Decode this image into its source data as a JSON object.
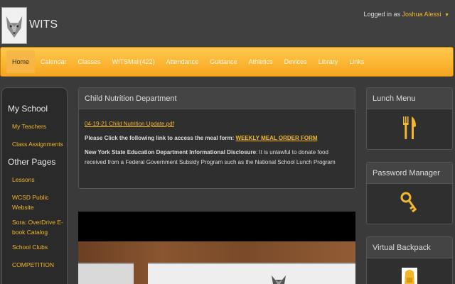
{
  "header": {
    "brand": "WITS",
    "logged_in_prefix": "Logged in as",
    "user": "Joshua Alessi"
  },
  "nav": {
    "items": [
      "Home",
      "Calendar",
      "Classes",
      "WITSMail(422)",
      "Attendance",
      "Guidance",
      "Athletics",
      "Devices",
      "Library",
      "Links"
    ],
    "active": "Home"
  },
  "sidebar": {
    "my_school_heading": "My School",
    "my_school_links": [
      "My Teachers",
      "Class Assignments"
    ],
    "other_pages_heading": "Other Pages",
    "other_links": [
      "Lessons",
      "WCSD Public Website",
      "Sora: OverDrive E-book Catalog",
      "School Clubs",
      "COMPETITION"
    ]
  },
  "main": {
    "title": "Child Nutrition Department",
    "pdf_link": "04-19-21 Child Nutrition Update.pdf",
    "instruction": "Please Click the following link to access the meal form:",
    "form_link": "WEEKLY MEAL ORDER FORM",
    "disclosure_label": "New York State Education Department Informational Disclosure",
    "disclosure_text": ": It is unlawful to donate food received from a Federal Government Subsidy Program such as the National School Lunch Program"
  },
  "right": {
    "lunch_title": "Lunch Menu",
    "lunch_icon": "fork-knife-icon",
    "password_title": "Password Manager",
    "password_icon": "key-icon",
    "backpack_title": "Virtual Backpack",
    "backpack_icon": "backpack-icon"
  },
  "colors": {
    "accent": "#f3b72b",
    "nav_top": "#ffc94d",
    "nav_bottom": "#f6a51f",
    "background": "#3a3a3a"
  }
}
